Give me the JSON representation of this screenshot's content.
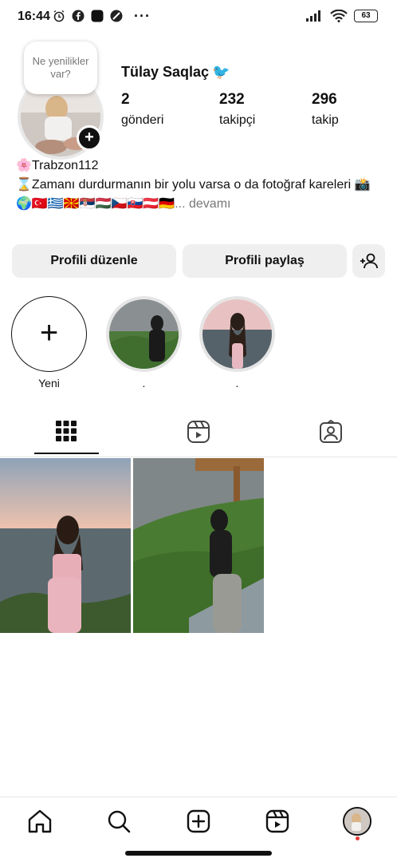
{
  "status_bar": {
    "time": "16:44",
    "battery": "63"
  },
  "profile": {
    "note": "Ne yenilikler var?",
    "name": "Tülay Saqlaç",
    "name_emoji": "🐦",
    "stats": [
      {
        "count": "2",
        "label": "gönderi"
      },
      {
        "count": "232",
        "label": "takipçi"
      },
      {
        "count": "296",
        "label": "takip"
      }
    ]
  },
  "bio": {
    "line1": "🌸Trabzon112",
    "line2": "⌛Zamanı durdurmanın bir yolu varsa o da fotoğraf kareleri 📸",
    "line3": "🌍🇹🇷🇬🇷🇲🇰🇷🇸🇭🇺🇨🇿🇸🇰🇦🇹🇩🇪",
    "more": "... devamı"
  },
  "buttons": {
    "edit": "Profili düzenle",
    "share": "Profili paylaş"
  },
  "highlights": [
    {
      "label": "Yeni"
    },
    {
      "label": "."
    },
    {
      "label": "."
    }
  ],
  "colors": {
    "accent": "#111111",
    "badge_red": "#e53935",
    "link_bird": "#3a9be0"
  }
}
